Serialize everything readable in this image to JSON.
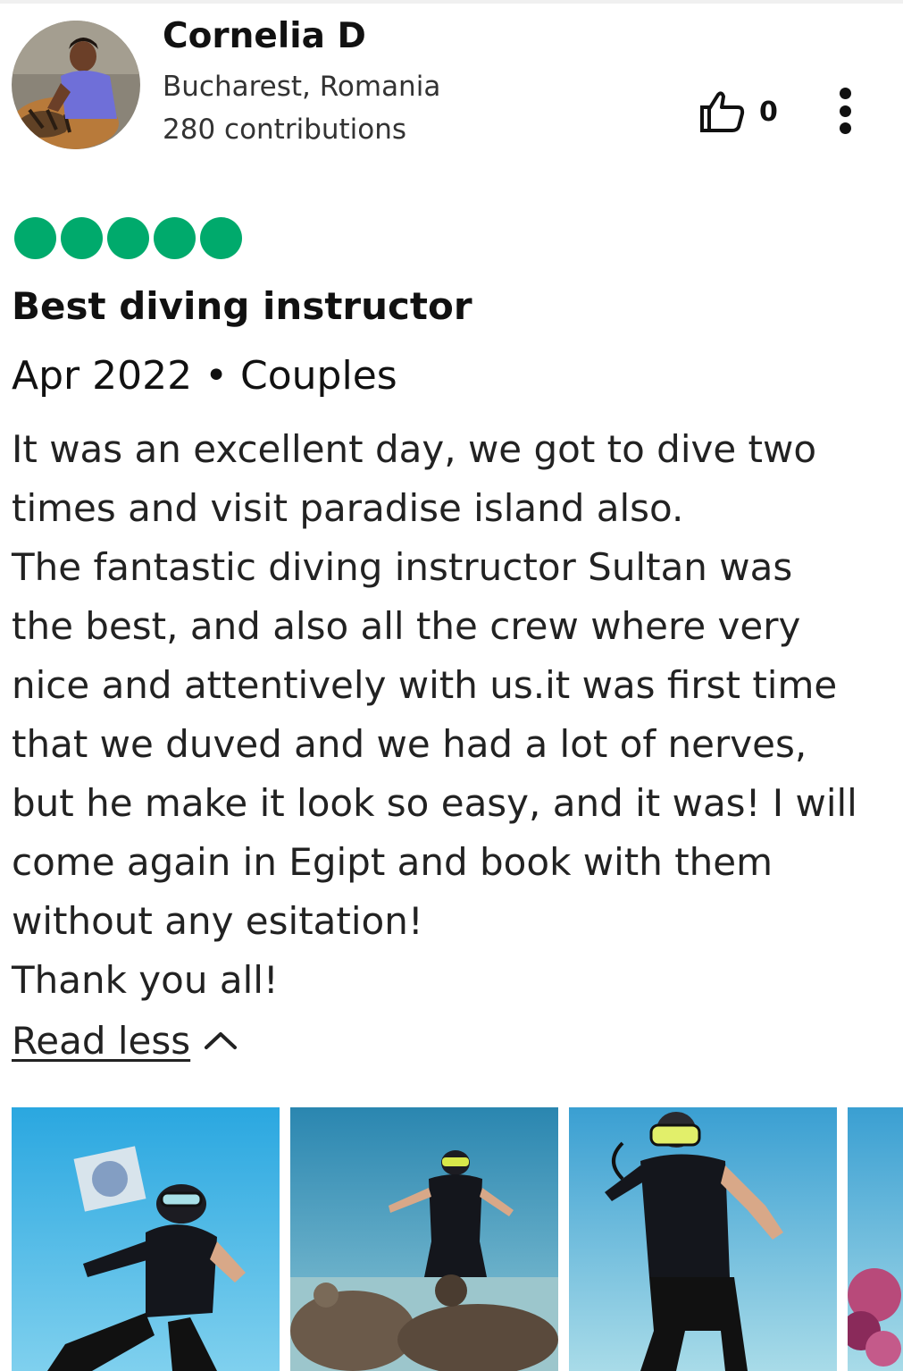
{
  "reviewer": {
    "name": "Cornelia D",
    "location": "Bucharest, Romania",
    "contributions": "280 contributions",
    "avatar_icon": "avatar-photo"
  },
  "actions": {
    "helpful_icon": "thumbs-up-icon",
    "helpful_count": "0",
    "more_icon": "more-vertical-icon"
  },
  "review": {
    "rating": 5,
    "rating_max": 5,
    "rating_color": "#00aa6c",
    "title": "Best diving instructor",
    "meta": "Apr 2022 • Couples",
    "body_lines": [
      "It was an excellent day, we got to dive two",
      "times and visit paradise island also.",
      "The fantastic diving instructor Sultan was",
      "the best, and also all the crew where very",
      "nice and attentively with us.it was first time",
      "that we duved and we had a lot of nerves,",
      "but he make it look so easy, and it was! I will",
      "come again in Egipt and book with them",
      "without any esitation!",
      "Thank you all!"
    ],
    "read_less_label": "Read less",
    "read_less_icon": "chevron-up-icon"
  },
  "photos": [
    {
      "name": "review-photo-1"
    },
    {
      "name": "review-photo-2"
    },
    {
      "name": "review-photo-3"
    },
    {
      "name": "review-photo-4"
    }
  ]
}
